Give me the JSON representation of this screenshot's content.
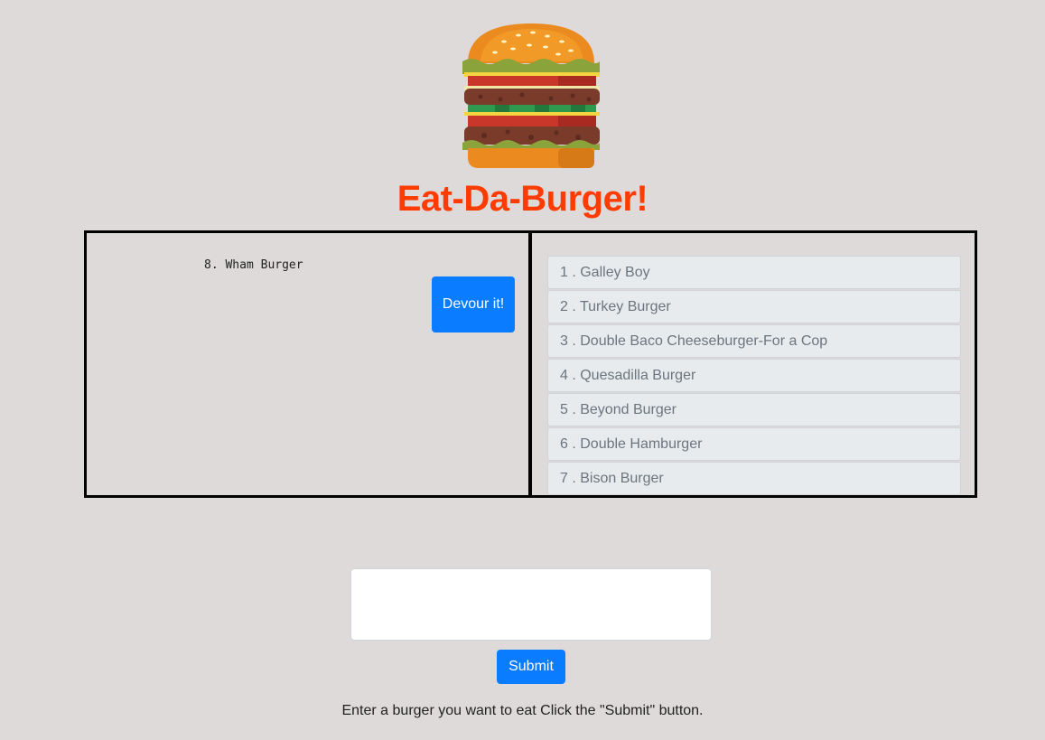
{
  "header": {
    "logo_icon": "hamburger-icon",
    "title": "Eat-Da-Burger!",
    "title_color": "#ff3b00"
  },
  "uneaten": {
    "items": [
      {
        "label": "8. Wham Burger",
        "button_label": "Devour it!"
      }
    ]
  },
  "eaten": {
    "items": [
      "1 . Galley Boy",
      "2 . Turkey Burger",
      "3 . Double Baco Cheeseburger-For a Cop",
      "4 . Quesadilla Burger",
      "5 . Beyond Burger",
      "6 . Double Hamburger",
      "7 . Bison Burger"
    ]
  },
  "form": {
    "input_value": "",
    "submit_label": "Submit",
    "instructions": "Enter a burger you want to eat Click the \"Submit\" button."
  },
  "colors": {
    "background": "#dddad9",
    "button": "#0a7cff",
    "list_item_bg": "#e8ebee"
  }
}
